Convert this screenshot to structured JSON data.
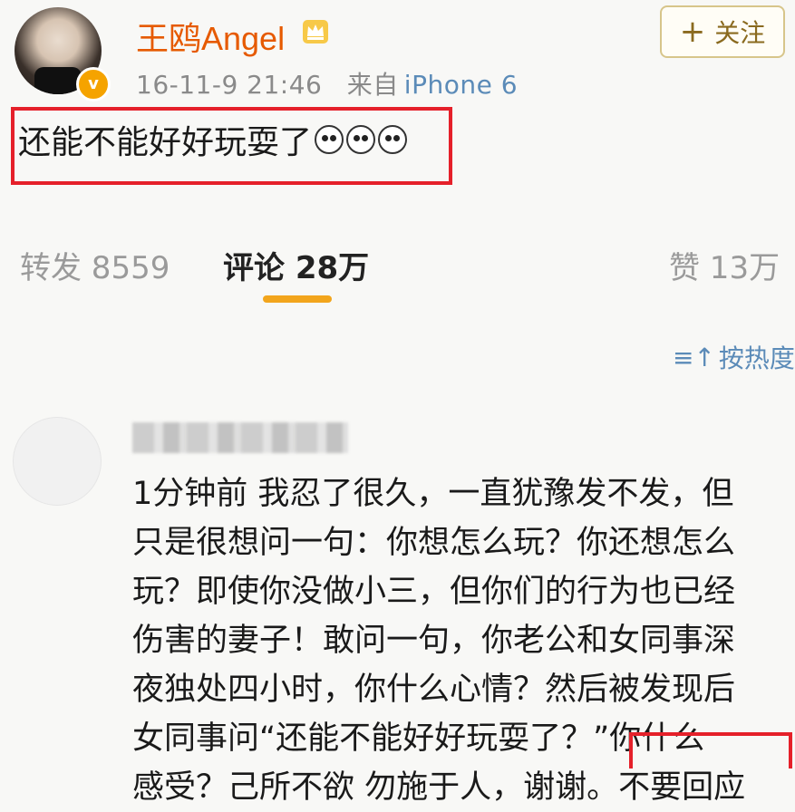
{
  "header": {
    "username": "王鸥Angel",
    "timestamp": "16-11-9 21:46",
    "source_prefix": "来自",
    "source": "iPhone 6",
    "follow_plus": "+",
    "follow_label": "关注"
  },
  "post": {
    "text": "还能不能好好玩耍了"
  },
  "stats": {
    "repost": "转发 8559",
    "comment": "评论 28万",
    "like": "赞 13万"
  },
  "sort": {
    "icon": "≡↑",
    "label": "按热度"
  },
  "comment": {
    "text": "1分钟前 我忍了很久，一直犹豫发不发，但\n只是很想问一句：你想怎么玩？你还想怎么\n玩？即使你没做小三，但你们的行为也已经\n伤害的妻子！敢问一句，你老公和女同事深\n夜独处四小时，你什么心情？然后被发现后\n女同事问“还能不能好好玩耍了？”你什么\n感受？己所不欲 勿施于人，谢谢。不要回应"
  },
  "colors": {
    "username": "#e65a00",
    "link": "#5b8bb8",
    "highlight_box": "#e5202a",
    "tab_underline": "#f2a51c"
  }
}
